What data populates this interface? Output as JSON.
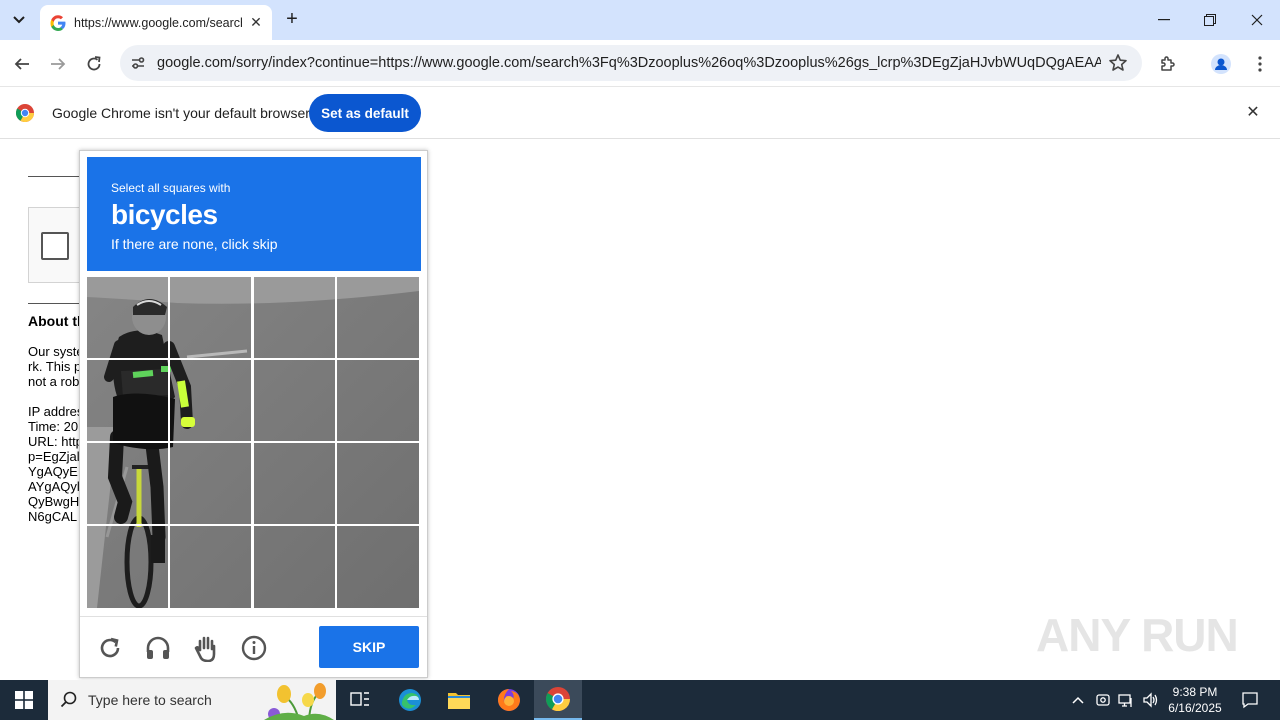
{
  "browser": {
    "tab": {
      "title": "https://www.google.com/search"
    },
    "address_bar": {
      "url": "google.com/sorry/index?continue=https://www.google.com/search%3Fq%3Dzooplus%26oq%3Dzooplus%26gs_lcrp%3DEgZjaHJvbWUqDQgAEAAY4w..."
    },
    "infobar": {
      "message": "Google Chrome isn't your default browser",
      "button": "Set as default"
    }
  },
  "background_page": {
    "about_title": "About th",
    "lines": [
      "Our syste",
      "rk. This p",
      "not a rob",
      "",
      "IP addres",
      "Time: 20",
      "URL: http",
      "p=EgZjal",
      "YgAQyE",
      "AYgAQyl",
      "QyBwgH",
      "N6gCAL"
    ]
  },
  "captcha": {
    "instruction_top": "Select all squares with",
    "target": "bicycles",
    "instruction_bottom": "If there are none, click skip",
    "skip_label": "SKIP",
    "colors": {
      "prompt_bg": "#1a73e8",
      "button_bg": "#1a73e8"
    }
  },
  "watermark": {
    "text": "ANY RUN"
  },
  "taskbar": {
    "search_placeholder": "Type here to search",
    "clock_time": "9:38 PM",
    "clock_date": "6/16/2025"
  }
}
